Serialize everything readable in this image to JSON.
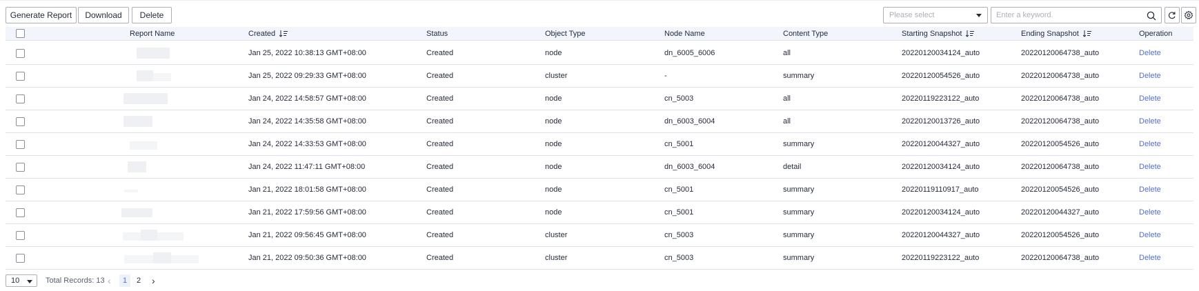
{
  "toolbar": {
    "generate_label": "Generate Report",
    "download_label": "Download",
    "delete_label": "Delete",
    "select_placeholder": "Please select",
    "search_placeholder": "Enter a keyword."
  },
  "table": {
    "columns": {
      "report_name": "Report Name",
      "created": "Created",
      "status": "Status",
      "object_type": "Object Type",
      "node_name": "Node Name",
      "content_type": "Content Type",
      "starting_snapshot": "Starting Snapshot",
      "ending_snapshot": "Ending Snapshot",
      "operation": "Operation"
    },
    "rows": [
      {
        "created": "Jan 25, 2022 10:38:13 GMT+08:00",
        "status": "Created",
        "object_type": "node",
        "node_name": "dn_6005_6006",
        "content_type": "all",
        "starting_snapshot": "20220120034124_auto",
        "ending_snapshot": "20220120064738_auto",
        "operation": "Delete"
      },
      {
        "created": "Jan 25, 2022 09:29:33 GMT+08:00",
        "status": "Created",
        "object_type": "cluster",
        "node_name": "-",
        "content_type": "summary",
        "starting_snapshot": "20220120054526_auto",
        "ending_snapshot": "20220120064738_auto",
        "operation": "Delete"
      },
      {
        "created": "Jan 24, 2022 14:58:57 GMT+08:00",
        "status": "Created",
        "object_type": "node",
        "node_name": "cn_5003",
        "content_type": "all",
        "starting_snapshot": "20220119223122_auto",
        "ending_snapshot": "20220120064738_auto",
        "operation": "Delete"
      },
      {
        "created": "Jan 24, 2022 14:35:58 GMT+08:00",
        "status": "Created",
        "object_type": "node",
        "node_name": "dn_6003_6004",
        "content_type": "all",
        "starting_snapshot": "20220120013726_auto",
        "ending_snapshot": "20220120064738_auto",
        "operation": "Delete"
      },
      {
        "created": "Jan 24, 2022 14:33:53 GMT+08:00",
        "status": "Created",
        "object_type": "node",
        "node_name": "cn_5001",
        "content_type": "summary",
        "starting_snapshot": "20220120044327_auto",
        "ending_snapshot": "20220120054526_auto",
        "operation": "Delete"
      },
      {
        "created": "Jan 24, 2022 11:47:11 GMT+08:00",
        "status": "Created",
        "object_type": "node",
        "node_name": "dn_6003_6004",
        "content_type": "detail",
        "starting_snapshot": "20220120034124_auto",
        "ending_snapshot": "20220120064738_auto",
        "operation": "Delete"
      },
      {
        "created": "Jan 21, 2022 18:01:58 GMT+08:00",
        "status": "Created",
        "object_type": "node",
        "node_name": "cn_5001",
        "content_type": "summary",
        "starting_snapshot": "20220119110917_auto",
        "ending_snapshot": "20220120054526_auto",
        "operation": "Delete"
      },
      {
        "created": "Jan 21, 2022 17:59:56 GMT+08:00",
        "status": "Created",
        "object_type": "node",
        "node_name": "cn_5001",
        "content_type": "summary",
        "starting_snapshot": "20220120034124_auto",
        "ending_snapshot": "20220120044327_auto",
        "operation": "Delete"
      },
      {
        "created": "Jan 21, 2022 09:56:45 GMT+08:00",
        "status": "Created",
        "object_type": "cluster",
        "node_name": "cn_5003",
        "content_type": "summary",
        "starting_snapshot": "20220120044327_auto",
        "ending_snapshot": "20220120054526_auto",
        "operation": "Delete"
      },
      {
        "created": "Jan 21, 2022 09:50:36 GMT+08:00",
        "status": "Created",
        "object_type": "cluster",
        "node_name": "cn_5003",
        "content_type": "summary",
        "starting_snapshot": "20220119223122_auto",
        "ending_snapshot": "20220120064738_auto",
        "operation": "Delete"
      }
    ]
  },
  "pagination": {
    "page_size": "10",
    "total": "Total Records: 13",
    "pages": [
      "1",
      "2"
    ],
    "current": "1"
  },
  "colors": {
    "accent": "#526ecc",
    "header_bg": "#f2f5fc",
    "border": "#dfe1e6"
  }
}
